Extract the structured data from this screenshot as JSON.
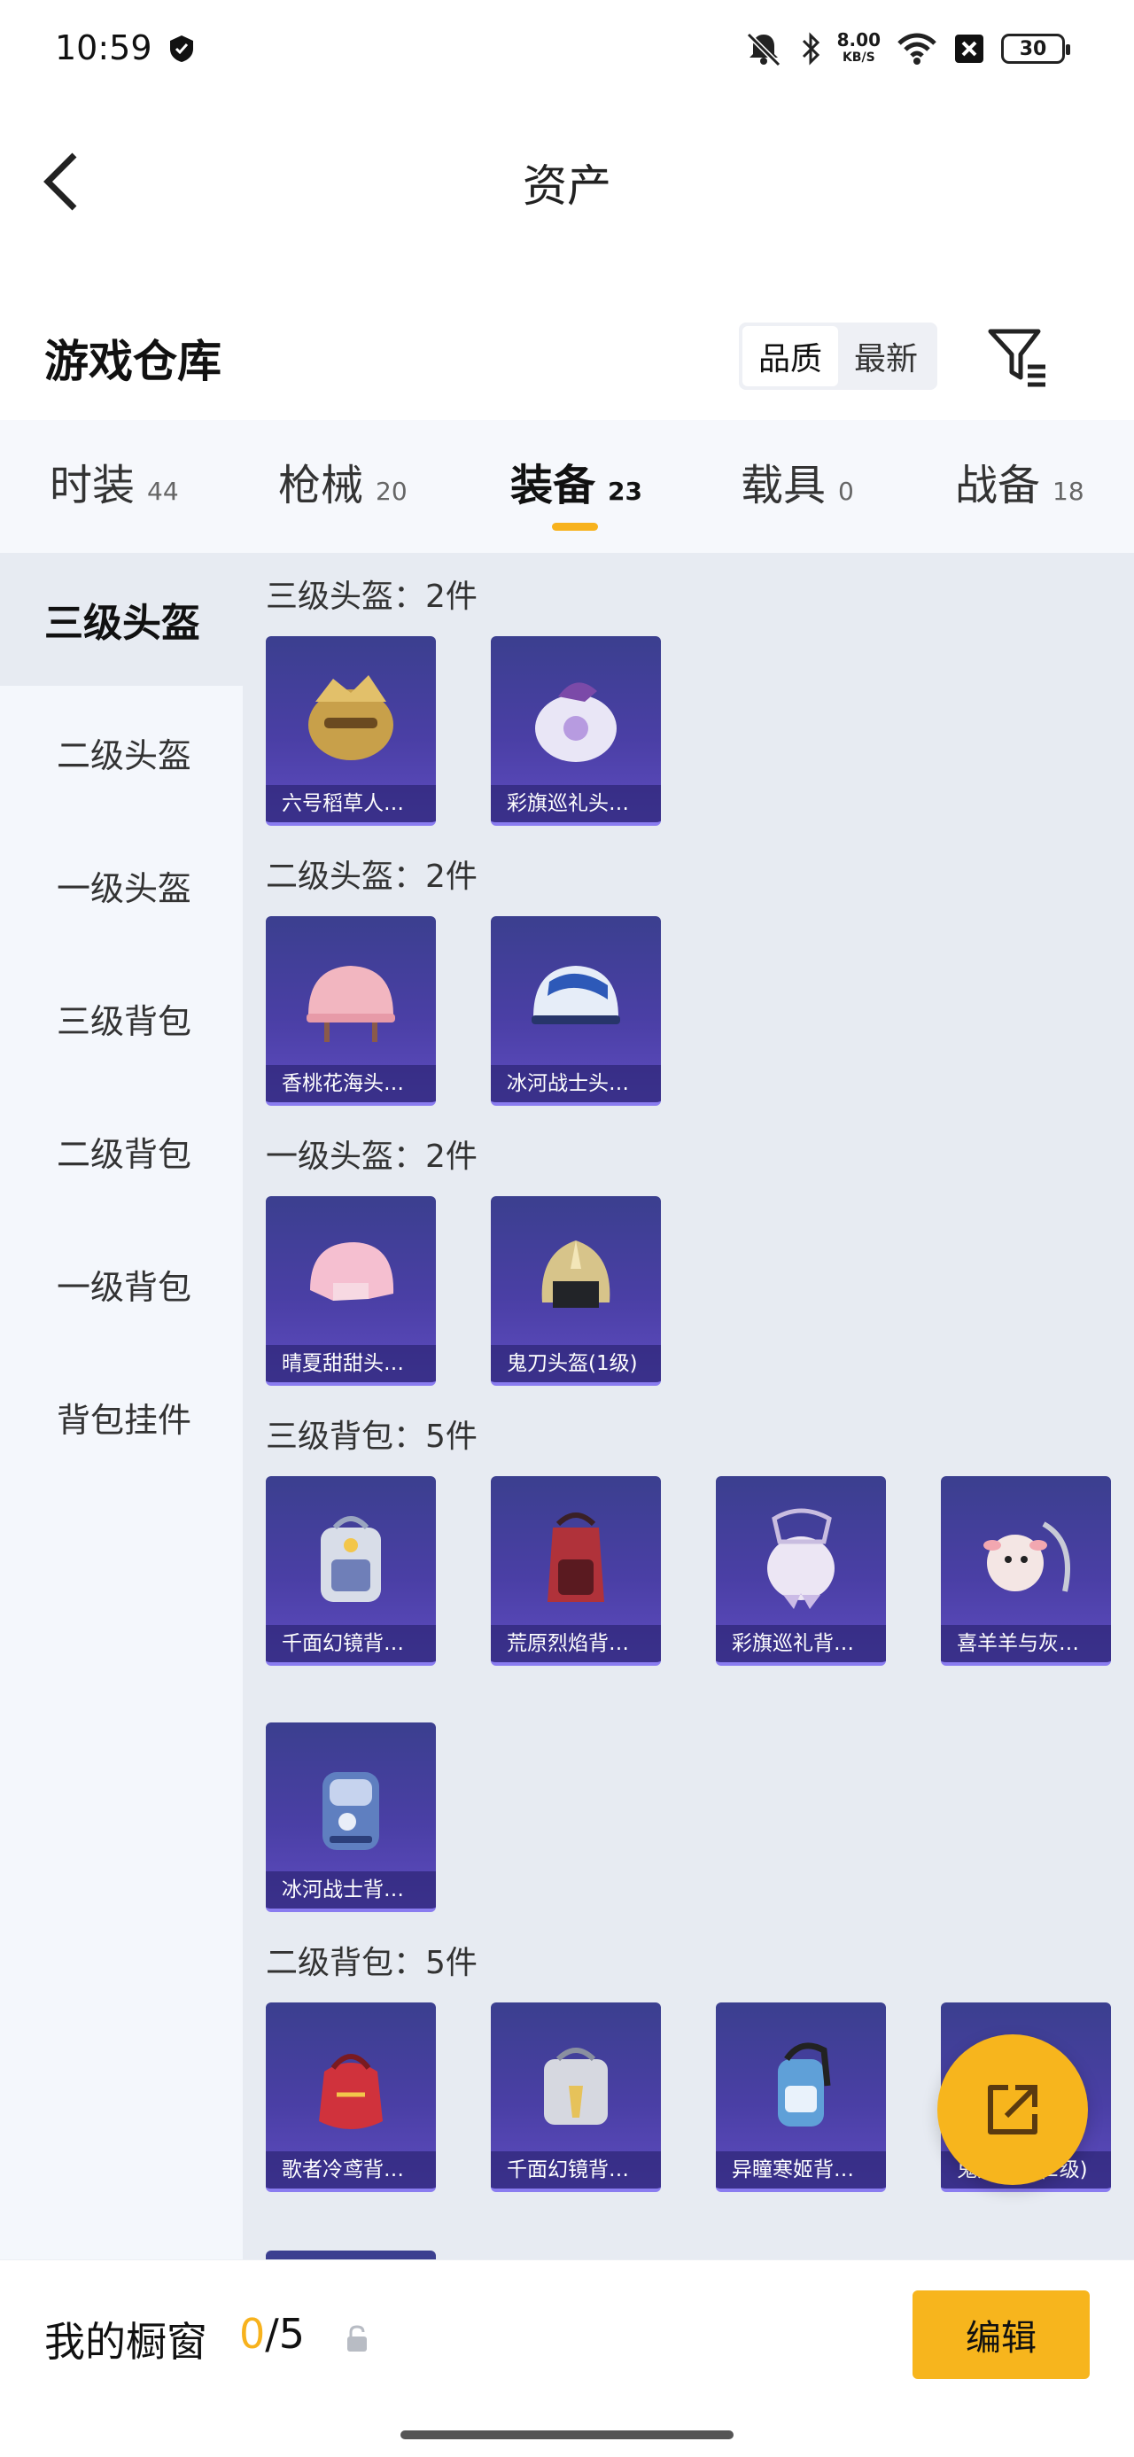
{
  "status_bar": {
    "time": "10:59",
    "net_speed": "8.00",
    "net_unit": "KB/S",
    "battery": "30"
  },
  "header": {
    "title": "资产"
  },
  "warehouse": {
    "title": "游戏仓库",
    "sort_options": [
      "品质",
      "最新"
    ],
    "sort_selected": "品质"
  },
  "tabs": [
    {
      "label": "时装",
      "count": "44"
    },
    {
      "label": "枪械",
      "count": "20"
    },
    {
      "label": "装备",
      "count": "23",
      "active": true
    },
    {
      "label": "载具",
      "count": "0"
    },
    {
      "label": "战备",
      "count": "18"
    }
  ],
  "sidebar": {
    "items": [
      "三级头盔",
      "二级头盔",
      "一级头盔",
      "三级背包",
      "二级背包",
      "一级背包",
      "背包挂件"
    ],
    "active": "三级头盔"
  },
  "sections": [
    {
      "title": "三级头盔：2件",
      "items": [
        {
          "name": "六号稻草人…",
          "icon": "scarecrow-helmet-icon",
          "color": "#c8a04a"
        },
        {
          "name": "彩旗巡礼头…",
          "icon": "parade-helmet-icon",
          "color": "#e9e6f6"
        }
      ]
    },
    {
      "title": "二级头盔：2件",
      "items": [
        {
          "name": "香桃花海头…",
          "icon": "peach-helmet-icon",
          "color": "#f2b6c0"
        },
        {
          "name": "冰河战士头…",
          "icon": "glacier-helmet-icon",
          "color": "#e6edf8"
        }
      ]
    },
    {
      "title": "一级头盔：2件",
      "items": [
        {
          "name": "晴夏甜甜头…",
          "icon": "summer-helmet-icon",
          "color": "#f5bfd0"
        },
        {
          "name": "鬼刀头盔(1级)",
          "icon": "ghostblade-helmet-icon",
          "color": "#d7c48a"
        }
      ]
    },
    {
      "title": "三级背包：5件",
      "items": [
        {
          "name": "千面幻镜背…",
          "icon": "mirror-backpack-icon",
          "color": "#d8dde8"
        },
        {
          "name": "荒原烈焰背…",
          "icon": "flame-backpack-icon",
          "color": "#b0323a"
        },
        {
          "name": "彩旗巡礼背…",
          "icon": "parade-backpack-icon",
          "color": "#ece6f4"
        },
        {
          "name": "喜羊羊与灰…",
          "icon": "sheep-backpack-icon",
          "color": "#f4e6e4"
        },
        {
          "name": "冰河战士背…",
          "icon": "glacier-backpack-icon",
          "color": "#5f7fc0"
        }
      ]
    },
    {
      "title": "二级背包：5件",
      "items": [
        {
          "name": "歌者冷鸢背…",
          "icon": "singer-backpack-icon",
          "color": "#d0323c"
        },
        {
          "name": "千面幻镜背…",
          "icon": "mirror-backpack-icon",
          "color": "#d6d8e0"
        },
        {
          "name": "异瞳寒姬背…",
          "icon": "frost-backpack-icon",
          "color": "#5fa0d8"
        },
        {
          "name": "鬼刀背包(2级)",
          "icon": "ghostblade-backpack-icon",
          "color": "#8a8f9a"
        }
      ]
    }
  ],
  "showcase": {
    "label": "我的橱窗",
    "current": "0",
    "separator": "/",
    "max": "5",
    "edit_label": "编辑"
  },
  "colors": {
    "accent": "#f7b51d",
    "card_bg": "#4a3fa5",
    "content_bg": "#e7ebf2"
  }
}
